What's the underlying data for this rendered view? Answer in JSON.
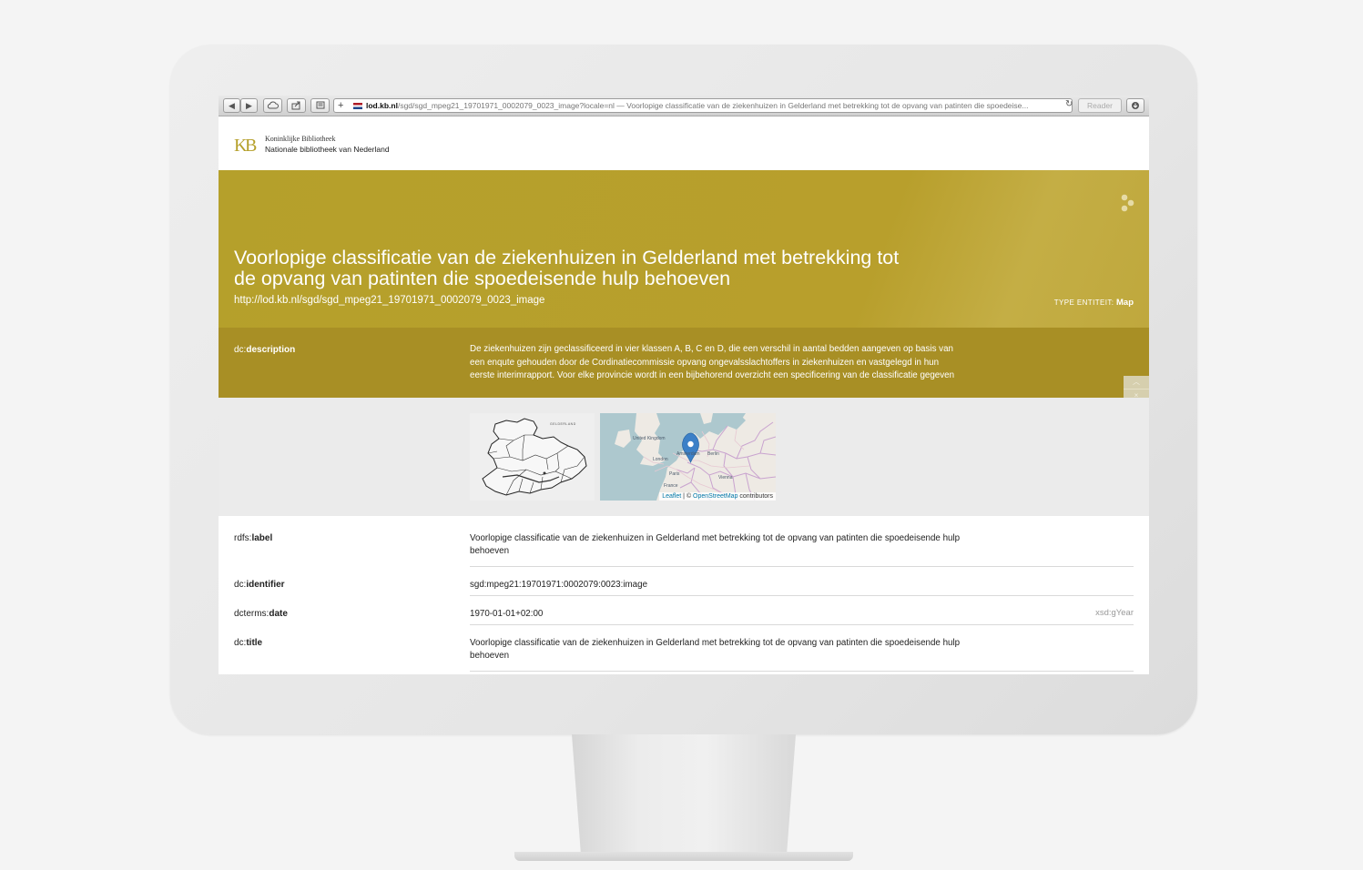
{
  "browser": {
    "address_host": "lod.kb.nl",
    "address_path": "/sgd/sgd_mpeg21_19701971_0002079_0023_image?locale=nl — Voorlopige classificatie van de ziekenhuizen in Gelderland met betrekking tot de opvang van patinten die spoedeise...",
    "reader_label": "Reader"
  },
  "header": {
    "logo_line1": "Koninklijke Bibliotheek",
    "logo_line2": "Nationale bibliotheek van Nederland",
    "brand_color": "#b5a02b"
  },
  "hero": {
    "title": "Voorlopige classificatie van de ziekenhuizen in Gelderland met betrekking tot de opvang van patinten die spoedeisende hulp behoeven",
    "uri": "http://lod.kb.nl/sgd/sgd_mpeg21_19701971_0002079_0023_image",
    "type_label": "TYPE ENTITEIT:",
    "type_value": "Map"
  },
  "description": {
    "prefix": "dc:",
    "key": "description",
    "text": "De ziekenhuizen zijn geclassificeerd in vier klassen A, B, C en D, die een verschil in aantal bedden aangeven op basis van een enqute gehouden door de Cordinatiecommissie opvang ongevalsslachtoffers in ziekenhuizen en vastgelegd in hun eerste interimrapport. Voor elke provincie wordt in een bijbehorend overzicht een specificering van de classificatie gegeven"
  },
  "thumbnail": {
    "label": "GELDERLAND"
  },
  "map": {
    "attr_leaflet": "Leaflet",
    "attr_sep": " | © ",
    "attr_osm": "OpenStreetMap",
    "attr_rest": " contributors",
    "labels": [
      "United Kingdom",
      "London",
      "Amsterdam",
      "Berlin",
      "Paris",
      "France",
      "Vienna"
    ]
  },
  "properties": [
    {
      "prefix": "rdfs:",
      "key": "label",
      "value": "Voorlopige classificatie van de ziekenhuizen in Gelderland met betrekking tot de opvang van patinten die spoedeisende hulp behoeven",
      "type": ""
    },
    {
      "prefix": "dc:",
      "key": "identifier",
      "value": "sgd:mpeg21:19701971:0002079:0023:image",
      "type": ""
    },
    {
      "prefix": "dcterms:",
      "key": "date",
      "value": "1970-01-01+02:00",
      "type": "xsd:gYear"
    },
    {
      "prefix": "dc:",
      "key": "title",
      "value": "Voorlopige classificatie van de ziekenhuizen in Gelderland met betrekking tot de opvang van patinten die spoedeisende hulp behoeven",
      "type": ""
    }
  ]
}
